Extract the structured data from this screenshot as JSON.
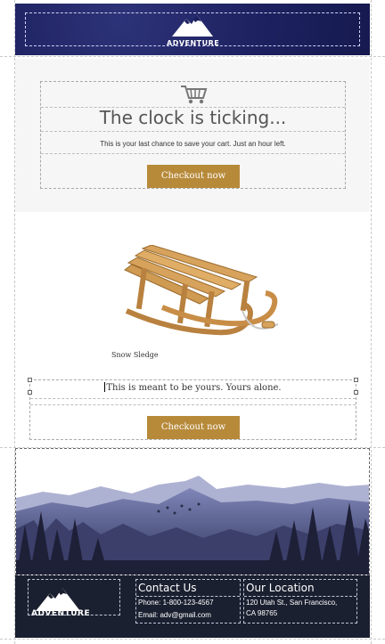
{
  "header": {
    "logo_text": "ADVENTURE"
  },
  "cart": {
    "icon": "shopping-cart-icon",
    "title": "The clock is ticking...",
    "text": "This is your last chance to save your cart. Just an hour left.",
    "button": "Checkout now"
  },
  "product": {
    "image": "snow-sledge-image",
    "caption": "Snow Sledge",
    "message": "This is meant to be yours. Yours alone.",
    "button": "Checkout now"
  },
  "banner": {
    "image": "mountain-landscape-image"
  },
  "footer": {
    "logo_text": "ADVENTURE",
    "contact": {
      "heading": "Contact Us",
      "phone": "Phone: 1-800-123-4567",
      "email": "Email: adv@gmail.com"
    },
    "location": {
      "heading": "Our Location",
      "line1": "120 Utah St., San Francisco,",
      "line2": "CA 98765"
    }
  },
  "colors": {
    "header_bg": "#1d2160",
    "button_bg": "#b78a3a",
    "footer_bg": "#1b2030",
    "section_bg": "#f6f6f6"
  }
}
